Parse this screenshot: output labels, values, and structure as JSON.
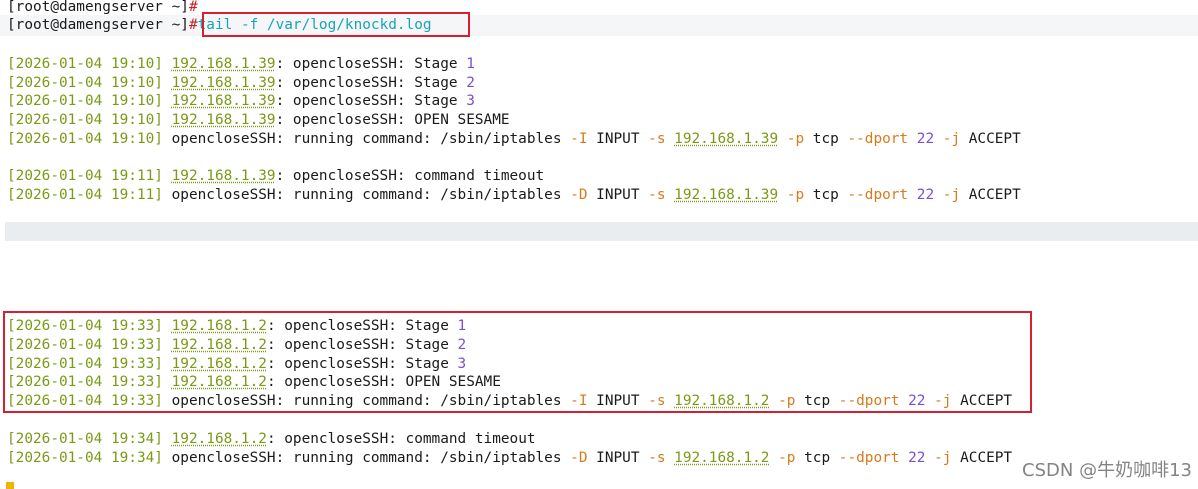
{
  "terminal": {
    "prompt": "[root@damengserver ~]",
    "prompt_symbol": "#",
    "command": "tail -f /var/log/knockd.log"
  },
  "log_lines": [
    {
      "ts": "[2026-01-04 19:10]",
      "ip": "192.168.1.39",
      "msg": "opencloseSSH: Stage ",
      "num": "1"
    },
    {
      "ts": "[2026-01-04 19:10]",
      "ip": "192.168.1.39",
      "msg": "opencloseSSH: Stage ",
      "num": "2"
    },
    {
      "ts": "[2026-01-04 19:10]",
      "ip": "192.168.1.39",
      "msg": "opencloseSSH: Stage ",
      "num": "3"
    },
    {
      "ts": "[2026-01-04 19:10]",
      "ip": "192.168.1.39",
      "msg": "opencloseSSH: OPEN SESAME",
      "num": ""
    },
    {
      "ts": "[2026-01-04 19:10]",
      "cmdline": {
        "pre": "opencloseSSH: running command: /sbin/iptables ",
        "flag": "-I",
        "chain": " INPUT ",
        "sflag": "-s",
        "ip": "192.168.1.39",
        "pflag": "-p",
        "proto": " tcp ",
        "dflag": "--dport",
        "port": "22",
        "jflag": "-j",
        "target": " ACCEPT"
      }
    },
    {
      "ts": "[2026-01-04 19:11]",
      "ip": "192.168.1.39",
      "msg": "opencloseSSH: command timeout",
      "num": ""
    },
    {
      "ts": "[2026-01-04 19:11]",
      "cmdline": {
        "pre": "opencloseSSH: running command: /sbin/iptables ",
        "flag": "-D",
        "chain": " INPUT ",
        "sflag": "-s",
        "ip": "192.168.1.39",
        "pflag": "-p",
        "proto": " tcp ",
        "dflag": "--dport",
        "port": "22",
        "jflag": "-j",
        "target": " ACCEPT"
      }
    },
    {
      "ts": "[2026-01-04 19:33]",
      "ip": "192.168.1.2",
      "msg": "opencloseSSH: Stage ",
      "num": "1"
    },
    {
      "ts": "[2026-01-04 19:33]",
      "ip": "192.168.1.2",
      "msg": "opencloseSSH: Stage ",
      "num": "2"
    },
    {
      "ts": "[2026-01-04 19:33]",
      "ip": "192.168.1.2",
      "msg": "opencloseSSH: Stage ",
      "num": "3"
    },
    {
      "ts": "[2026-01-04 19:33]",
      "ip": "192.168.1.2",
      "msg": "opencloseSSH: OPEN SESAME",
      "num": ""
    },
    {
      "ts": "[2026-01-04 19:33]",
      "cmdline": {
        "pre": "opencloseSSH: running command: /sbin/iptables ",
        "flag": "-I",
        "chain": " INPUT ",
        "sflag": "-s",
        "ip": "192.168.1.2",
        "pflag": "-p",
        "proto": " tcp ",
        "dflag": "--dport",
        "port": "22",
        "jflag": "-j",
        "target": " ACCEPT"
      }
    },
    {
      "ts": "[2026-01-04 19:34]",
      "ip": "192.168.1.2",
      "msg": "opencloseSSH: command timeout",
      "num": ""
    },
    {
      "ts": "[2026-01-04 19:34]",
      "cmdline": {
        "pre": "opencloseSSH: running command: /sbin/iptables ",
        "flag": "-D",
        "chain": " INPUT ",
        "sflag": "-s",
        "ip": "192.168.1.2",
        "pflag": "-p",
        "proto": " tcp ",
        "dflag": "--dport",
        "port": "22",
        "jflag": "-j",
        "target": " ACCEPT"
      }
    }
  ],
  "watermark": "CSDN @牛奶咖啡13",
  "colors": {
    "timestamp": "#7a9a15",
    "ip": "#7a9a15",
    "command": "#19a4b8",
    "number": "#7a4fd6",
    "option": "#d97a1a",
    "highlight_box": "#d42030",
    "cursor": "#f0b400"
  }
}
